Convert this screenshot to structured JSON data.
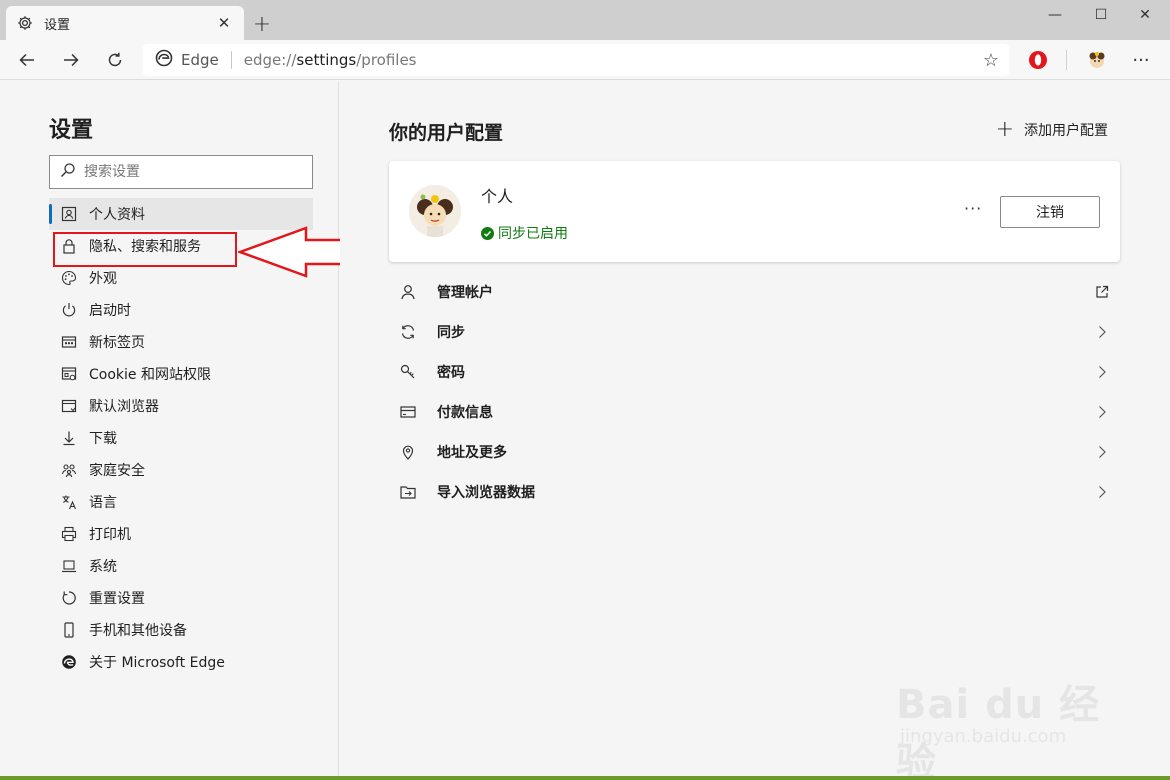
{
  "window": {
    "tab_title": "设置",
    "tab_close": "✕",
    "new_tab": "+",
    "minimize": "—",
    "maximize": "☐",
    "close": "✕"
  },
  "toolbar": {
    "address_brand": "Edge",
    "url_scheme": "edge://",
    "url_host": "settings",
    "url_path": "/profiles"
  },
  "sidebar": {
    "title": "设置",
    "search_placeholder": "搜索设置",
    "items": [
      {
        "label": "个人资料",
        "icon": "profile-card-icon",
        "active": true
      },
      {
        "label": "隐私、搜索和服务",
        "icon": "lock-icon"
      },
      {
        "label": "外观",
        "icon": "palette-icon"
      },
      {
        "label": "启动时",
        "icon": "power-icon"
      },
      {
        "label": "新标签页",
        "icon": "newtab-page-icon"
      },
      {
        "label": "Cookie 和网站权限",
        "icon": "site-permissions-icon"
      },
      {
        "label": "默认浏览器",
        "icon": "default-browser-icon"
      },
      {
        "label": "下载",
        "icon": "download-icon"
      },
      {
        "label": "家庭安全",
        "icon": "family-icon"
      },
      {
        "label": "语言",
        "icon": "language-icon"
      },
      {
        "label": "打印机",
        "icon": "printer-icon"
      },
      {
        "label": "系统",
        "icon": "laptop-icon"
      },
      {
        "label": "重置设置",
        "icon": "reset-icon"
      },
      {
        "label": "手机和其他设备",
        "icon": "phone-icon"
      },
      {
        "label": "关于 Microsoft Edge",
        "icon": "edge-logo-icon"
      }
    ]
  },
  "main": {
    "title": "你的用户配置",
    "add_profile": "添加用户配置",
    "profile": {
      "name": "个人",
      "sync_status": "同步已启用",
      "more": "···",
      "signout": "注销"
    },
    "menu": [
      {
        "label": "管理帐户",
        "icon": "person-icon",
        "end": "external-link-icon"
      },
      {
        "label": "同步",
        "icon": "sync-icon",
        "end": "chevron-right-icon"
      },
      {
        "label": "密码",
        "icon": "key-icon",
        "end": "chevron-right-icon"
      },
      {
        "label": "付款信息",
        "icon": "card-icon",
        "end": "chevron-right-icon"
      },
      {
        "label": "地址及更多",
        "icon": "location-pin-icon",
        "end": "chevron-right-icon"
      },
      {
        "label": "导入浏览器数据",
        "icon": "import-folder-icon",
        "end": "chevron-right-icon"
      }
    ]
  },
  "watermark": {
    "brand": "Bai du 经验",
    "sub": "jingyan.baidu.com"
  },
  "colors": {
    "accent": "#0f6cbd",
    "sync_green": "#107c10",
    "annotation_red": "#e2161b"
  }
}
